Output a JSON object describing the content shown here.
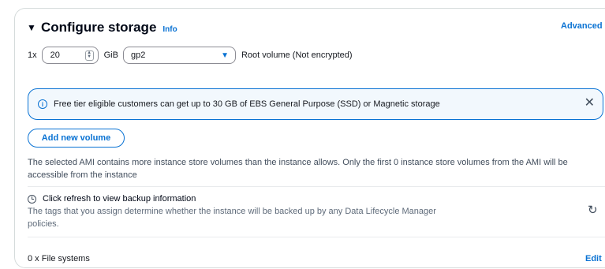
{
  "section": {
    "title": "Configure storage",
    "info_label": "Info",
    "advanced_label": "Advanced"
  },
  "volume": {
    "multiplier": "1x",
    "size_value": "20",
    "size_unit": "GiB",
    "volume_type": "gp2",
    "root_label": "Root volume  (Not encrypted)"
  },
  "alert": {
    "text": "Free tier eligible customers can get up to 30 GB of EBS General Purpose (SSD) or Magnetic storage"
  },
  "add_volume_label": "Add new volume",
  "ami_note": "The selected AMI contains more instance store volumes than the instance allows. Only the first 0 instance store volumes from the AMI will be accessible from the instance",
  "backup": {
    "title": "Click refresh to view backup information",
    "description": "The tags that you assign determine whether the instance will be backed up by any Data Lifecycle Manager policies."
  },
  "file_systems": {
    "label": "0 x File systems",
    "edit_label": "Edit"
  },
  "colors": {
    "accent": "#0972d3",
    "alert_bg": "#f2f8fd",
    "text": "#16191f"
  },
  "icons": {
    "caret": "caret-down-icon",
    "info": "info-circle-icon",
    "close": "close-icon",
    "clock": "clock-icon",
    "refresh": "refresh-icon"
  }
}
